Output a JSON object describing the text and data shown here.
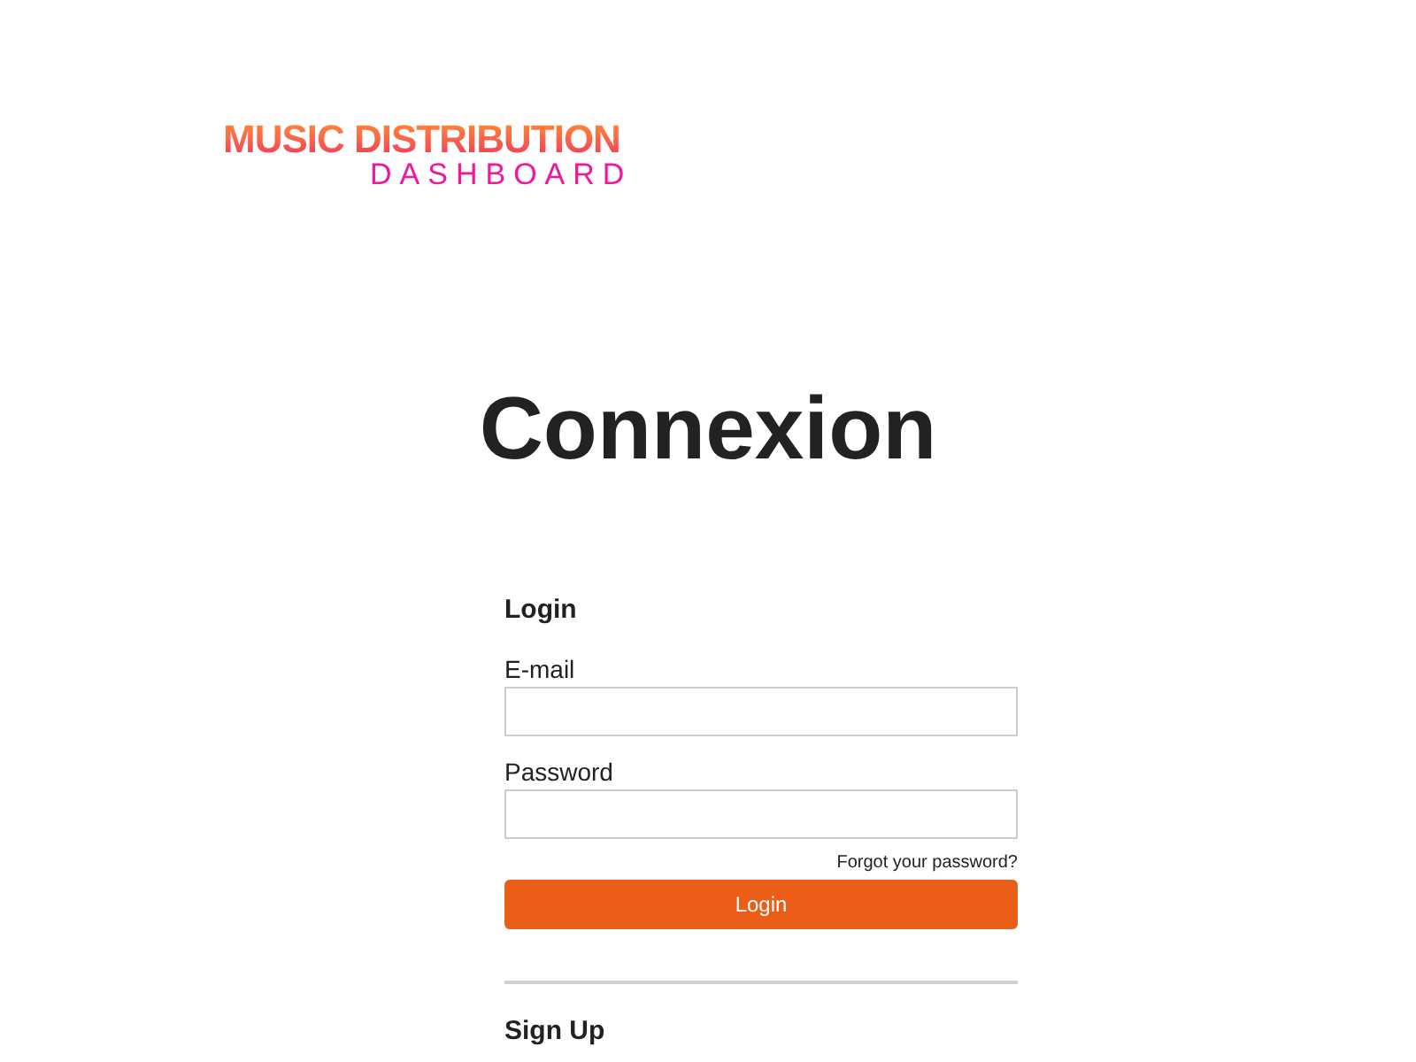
{
  "logo": {
    "line_1": "MUSIC DISTRIBUTION",
    "line_2": "DASHBOARD"
  },
  "title": "Connexion",
  "login": {
    "heading": "Login",
    "fields": [
      {
        "label": "E-mail"
      },
      {
        "label": "Password"
      }
    ],
    "forgot_link": "Forgot your password?",
    "button": "Login"
  },
  "signup": {
    "heading": "Sign Up"
  }
}
